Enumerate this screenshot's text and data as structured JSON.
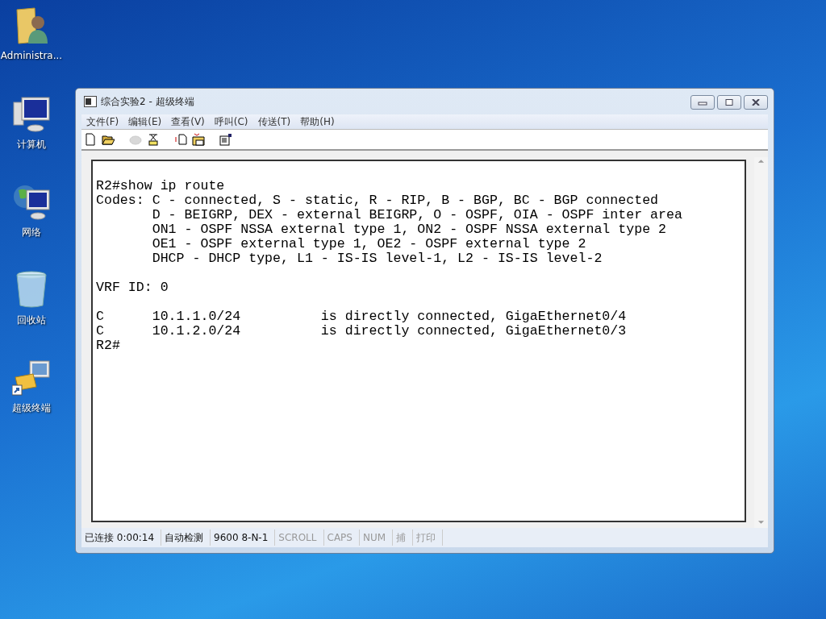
{
  "desktop_icons": [
    {
      "kind": "user-folder",
      "label": "Administra..."
    },
    {
      "kind": "computer",
      "label": "计算机"
    },
    {
      "kind": "network",
      "label": "网络"
    },
    {
      "kind": "recycle-bin",
      "label": "回收站"
    },
    {
      "kind": "terminal-shortcut",
      "label": "超级终端"
    }
  ],
  "window": {
    "title": "综合实验2 - 超级终端",
    "menu": [
      "文件(F)",
      "编辑(E)",
      "查看(V)",
      "呼叫(C)",
      "传送(T)",
      "帮助(H)"
    ],
    "toolbar": [
      {
        "kind": "new",
        "enabled": true
      },
      {
        "kind": "open",
        "enabled": true
      },
      {
        "kind": "sep"
      },
      {
        "kind": "call",
        "enabled": false
      },
      {
        "kind": "hangup",
        "enabled": true
      },
      {
        "kind": "sep"
      },
      {
        "kind": "send",
        "enabled": true
      },
      {
        "kind": "receive",
        "enabled": true
      },
      {
        "kind": "sep"
      },
      {
        "kind": "properties",
        "enabled": true
      }
    ],
    "terminal": [
      [
        "R2#show ip route",
        "Codes: C - connected, S - static, R - RIP, B - BGP, BC - BGP connected",
        "       D - BEIGRP, DEX - external BEIGRP, O - OSPF, OIA - OSPF inter area",
        "       ON1 - OSPF NSSA external type 1, ON2 - OSPF NSSA external type 2",
        "       OE1 - OSPF external type 1, OE2 - OSPF external type 2",
        "       DHCP - DHCP type, L1 - IS-IS level-1, L2 - IS-IS level-2"
      ],
      [
        "VRF ID: 0"
      ],
      [
        "C      10.1.1.0/24          is directly connected, GigaEthernet0/4",
        "C      10.1.2.0/24          is directly connected, GigaEthernet0/3",
        "R2#"
      ]
    ],
    "status_bar": [
      {
        "text": "已连接 0:00:14",
        "enabled": true
      },
      {
        "text": "自动检测",
        "enabled": true
      },
      {
        "text": "9600 8-N-1",
        "enabled": true
      },
      {
        "text": "SCROLL",
        "enabled": false
      },
      {
        "text": "CAPS",
        "enabled": false
      },
      {
        "text": "NUM",
        "enabled": false
      },
      {
        "text": "捕",
        "enabled": false
      },
      {
        "text": "打印",
        "enabled": false
      }
    ]
  }
}
